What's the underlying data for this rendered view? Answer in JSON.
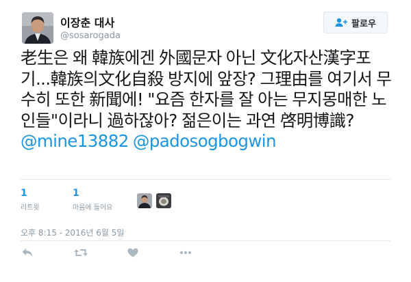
{
  "user": {
    "name": "이장춘 대사",
    "handle": "@sosarogada"
  },
  "follow_button": {
    "label": "팔로우",
    "icon": "add-user-icon"
  },
  "tweet": {
    "text_segments": [
      "老生은 왜 韓族에겐 外國문자 아닌 文化자산漢字포기...韓族의文化自殺 방지에 앞장? 그理由를 여기서 무수히 또한 新聞에! \"요즘 한자를 잘 아는 무지몽매한 노인들\"이라니 過하잖아? 젊은이는 과연 啓明博識? ",
      "@mine13882",
      " ",
      "@padosogbogwin"
    ]
  },
  "stats": {
    "retweets": {
      "count": "1",
      "label": "리트윗"
    },
    "likes": {
      "count": "1",
      "label": "마음에 들어요"
    }
  },
  "timestamp": "오후 8:15 - 2016년 6월 5일",
  "actions": [
    "reply-icon",
    "retweet-icon",
    "like-icon",
    "more-icon"
  ],
  "colors": {
    "link": "#1b95e0",
    "muted": "#8899a6",
    "text": "#14171a",
    "border": "#e1e8ed"
  }
}
